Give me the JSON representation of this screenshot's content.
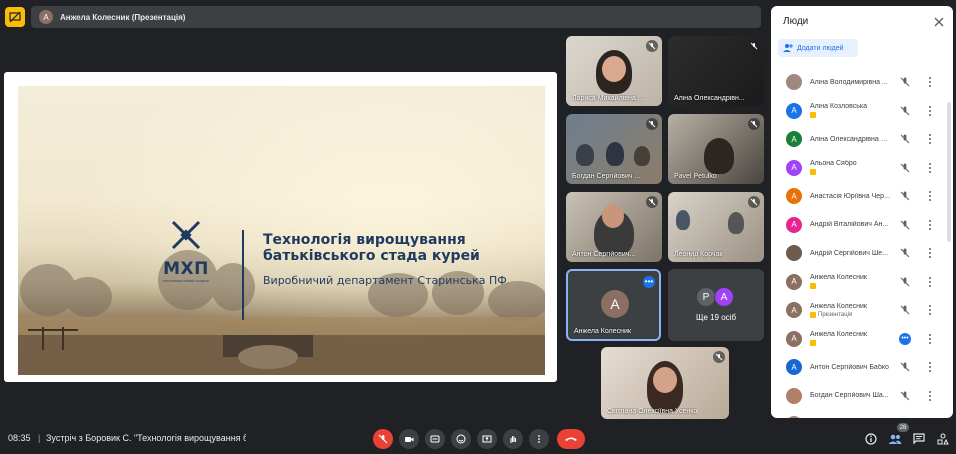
{
  "topbar": {
    "avatar_letter": "А",
    "title": "Анжела Колесник (Презентація)"
  },
  "slide": {
    "logo_text": "МХП",
    "logo_sub": "АГРОПРОМИСЛОВИЙ ХОЛДИНГ",
    "title": "Технологія вирощування батьківського стада курей",
    "subtitle": "Виробничий департамент Старинська ПФ"
  },
  "tiles": [
    {
      "name": "Лариса Михайлівна ..."
    },
    {
      "name": "Аліна Олександрівн..."
    },
    {
      "name": "Богдан Сергійович ..."
    },
    {
      "name": "Pavel Petulko"
    },
    {
      "name": "Антон Сергійович..."
    },
    {
      "name": "Леонид Корчак"
    },
    {
      "name": "Анжела Колесник",
      "avatar_letter": "А"
    },
    {
      "name": "Ще 19 осіб",
      "avatars": [
        "P",
        "А"
      ]
    },
    {
      "name": "Світлана Олексіївна Усенко"
    }
  ],
  "panel": {
    "title": "Люди",
    "add_label": "Додати людей",
    "people": [
      {
        "name": "Аліна Володимирівна ...",
        "letter": "",
        "color": "#a1887f",
        "tag": ""
      },
      {
        "name": "Аліна Козловська",
        "letter": "А",
        "color": "#1a73e8",
        "tag": "hand"
      },
      {
        "name": "Аліна Олександрівна К...",
        "letter": "А",
        "color": "#188038",
        "tag": ""
      },
      {
        "name": "Альона Сябро",
        "letter": "А",
        "color": "#a142f4",
        "tag": "hand"
      },
      {
        "name": "Анастасія Юріївна Чер...",
        "letter": "А",
        "color": "#e8710a",
        "tag": ""
      },
      {
        "name": "Андрій Віталійович Ан...",
        "letter": "А",
        "color": "#e52592",
        "tag": ""
      },
      {
        "name": "Андрій Сергійович Ше...",
        "letter": "",
        "color": "#6d5c4e",
        "tag": ""
      },
      {
        "name": "Анжела Колесник",
        "letter": "А",
        "color": "#8d6e63",
        "tag": "hand"
      },
      {
        "name": "Анжела Колесник",
        "letter": "А",
        "color": "#8d6e63",
        "tag": "Презентація"
      },
      {
        "name": "Анжела Колесник",
        "letter": "А",
        "color": "#8d6e63",
        "tag": "hand"
      },
      {
        "name": "Антон Сергійович Бабко",
        "letter": "А",
        "color": "#1967d2",
        "tag": ""
      },
      {
        "name": "Богдан Сергійович Ша...",
        "letter": "",
        "color": "#b0806a",
        "tag": ""
      },
      {
        "name": "",
        "letter": "",
        "color": "#9e8a7a",
        "tag": ""
      }
    ]
  },
  "bottom": {
    "time": "08:35",
    "separator": "|",
    "meeting_title": "Зустріч з Боровик С. \"Технологія вирощування ба...",
    "participants_count": "28"
  },
  "colors": {
    "background": "#202124",
    "accent": "#1a73e8",
    "danger": "#ea4335"
  }
}
